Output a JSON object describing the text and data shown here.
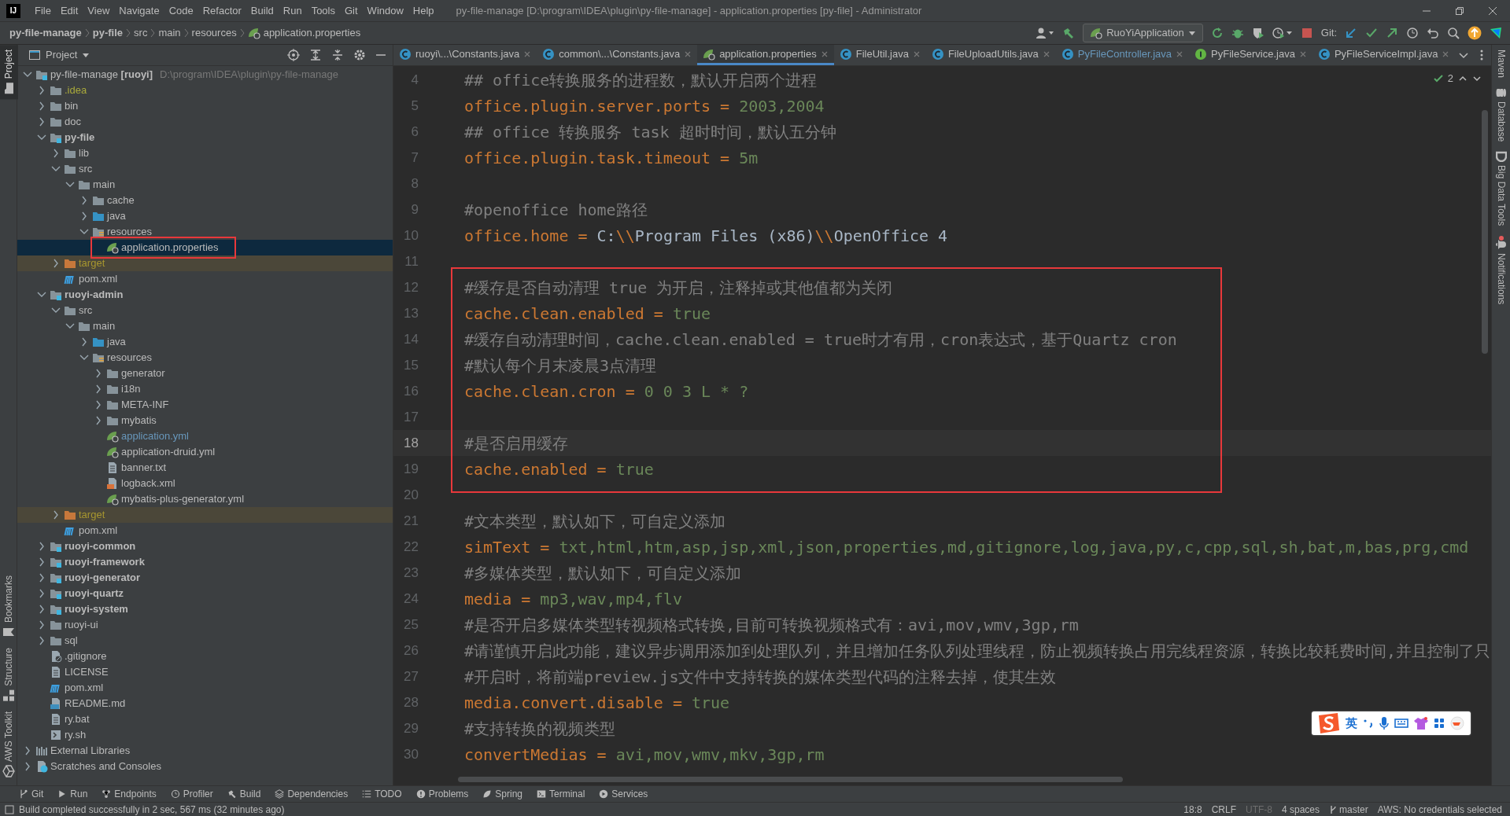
{
  "window": {
    "logo": "IJ",
    "menu": [
      "File",
      "Edit",
      "View",
      "Navigate",
      "Code",
      "Refactor",
      "Build",
      "Run",
      "Tools",
      "Git",
      "Window",
      "Help"
    ],
    "title": "py-file-manage [D:\\program\\IDEA\\plugin\\py-file-manage] - application.properties [py-file] - Administrator"
  },
  "navbar": {
    "breadcrumbs": [
      {
        "label": "py-file-manage",
        "bold": true,
        "kind": "module"
      },
      {
        "label": "py-file",
        "bold": true,
        "kind": "module"
      },
      {
        "label": "src",
        "bold": false,
        "kind": "folder"
      },
      {
        "label": "main",
        "bold": false,
        "kind": "folder"
      },
      {
        "label": "resources",
        "bold": false,
        "kind": "folder"
      },
      {
        "label": "application.properties",
        "bold": false,
        "kind": "spring"
      }
    ],
    "run_config": "RuoYiApplication",
    "git_label": "Git:"
  },
  "left_stripe": [
    {
      "label": "Project",
      "selected": true
    },
    {
      "label": "Bookmarks",
      "selected": false
    },
    {
      "label": "Structure",
      "selected": false
    },
    {
      "label": "AWS Toolkit",
      "selected": false
    }
  ],
  "project": {
    "title": "Project",
    "annotation_frame": true,
    "tree": [
      {
        "label": "py-file-manage **[ruoyi]**",
        "location": "D:\\program\\IDEA\\plugin\\py-file-manage",
        "kind": "project",
        "modified": false,
        "selected": false,
        "expanded": true,
        "children": [
          {
            "label": ".idea",
            "kind": "ignored",
            "modified": false,
            "selected": false,
            "expanded": false
          },
          {
            "label": "bin",
            "kind": "folder",
            "modified": false,
            "selected": false,
            "expanded": false
          },
          {
            "label": "doc",
            "kind": "folder",
            "modified": false,
            "selected": false,
            "expanded": false
          },
          {
            "label": "py-file",
            "kind": "module",
            "modified": false,
            "selected": false,
            "expanded": true,
            "children": [
              {
                "label": "lib",
                "kind": "folder",
                "modified": false,
                "selected": false,
                "expanded": false
              },
              {
                "label": "src",
                "kind": "folder",
                "modified": false,
                "selected": false,
                "expanded": true,
                "children": [
                  {
                    "label": "main",
                    "kind": "folder",
                    "modified": false,
                    "selected": false,
                    "expanded": true,
                    "children": [
                      {
                        "label": "cache",
                        "kind": "folder",
                        "modified": false,
                        "selected": false,
                        "expanded": false
                      },
                      {
                        "label": "java",
                        "kind": "source",
                        "modified": false,
                        "selected": false,
                        "expanded": false
                      },
                      {
                        "label": "resources",
                        "kind": "resources",
                        "modified": false,
                        "selected": false,
                        "expanded": true,
                        "children": [
                          {
                            "label": "application.properties",
                            "kind": "spring",
                            "modified": false,
                            "selected": true
                          }
                        ]
                      }
                    ]
                  }
                ]
              },
              {
                "label": "target",
                "kind": "excluded",
                "modified": false,
                "selected": false,
                "expanded": false
              },
              {
                "label": "pom.xml",
                "kind": "maven",
                "modified": false,
                "selected": false
              }
            ]
          },
          {
            "label": "ruoyi-admin",
            "kind": "module",
            "modified": false,
            "selected": false,
            "expanded": true,
            "children": [
              {
                "label": "src",
                "kind": "folder",
                "modified": false,
                "selected": false,
                "expanded": true,
                "children": [
                  {
                    "label": "main",
                    "kind": "folder",
                    "modified": false,
                    "selected": false,
                    "expanded": true,
                    "children": [
                      {
                        "label": "java",
                        "kind": "source",
                        "modified": false,
                        "selected": false,
                        "expanded": false
                      },
                      {
                        "label": "resources",
                        "kind": "resources",
                        "modified": false,
                        "selected": false,
                        "expanded": true,
                        "children": [
                          {
                            "label": "generator",
                            "kind": "folder",
                            "modified": false,
                            "selected": false,
                            "expanded": false
                          },
                          {
                            "label": "i18n",
                            "kind": "folder",
                            "modified": false,
                            "selected": false,
                            "expanded": false
                          },
                          {
                            "label": "META-INF",
                            "kind": "folder",
                            "modified": false,
                            "selected": false,
                            "expanded": false
                          },
                          {
                            "label": "mybatis",
                            "kind": "folder",
                            "modified": false,
                            "selected": false,
                            "expanded": false
                          },
                          {
                            "label": "application.yml",
                            "kind": "spring",
                            "modified": true,
                            "selected": false
                          },
                          {
                            "label": "application-druid.yml",
                            "kind": "spring",
                            "modified": false,
                            "selected": false
                          },
                          {
                            "label": "banner.txt",
                            "kind": "text",
                            "modified": false,
                            "selected": false
                          },
                          {
                            "label": "logback.xml",
                            "kind": "xml",
                            "modified": false,
                            "selected": false
                          },
                          {
                            "label": "mybatis-plus-generator.yml",
                            "kind": "spring",
                            "modified": false,
                            "selected": false
                          }
                        ]
                      }
                    ]
                  }
                ]
              },
              {
                "label": "target",
                "kind": "excluded",
                "modified": false,
                "selected": false,
                "expanded": false
              },
              {
                "label": "pom.xml",
                "kind": "maven",
                "modified": false,
                "selected": false
              }
            ]
          },
          {
            "label": "ruoyi-common",
            "kind": "module",
            "modified": false,
            "selected": false,
            "expanded": false
          },
          {
            "label": "ruoyi-framework",
            "kind": "module",
            "modified": false,
            "selected": false,
            "expanded": false
          },
          {
            "label": "ruoyi-generator",
            "kind": "module",
            "modified": false,
            "selected": false,
            "expanded": false
          },
          {
            "label": "ruoyi-quartz",
            "kind": "module",
            "modified": false,
            "selected": false,
            "expanded": false
          },
          {
            "label": "ruoyi-system",
            "kind": "module",
            "modified": false,
            "selected": false,
            "expanded": false
          },
          {
            "label": "ruoyi-ui",
            "kind": "folder",
            "modified": false,
            "selected": false,
            "expanded": false
          },
          {
            "label": "sql",
            "kind": "folder",
            "modified": false,
            "selected": false,
            "expanded": false
          },
          {
            "label": ".gitignore",
            "kind": "gitignore",
            "modified": false,
            "selected": false
          },
          {
            "label": "LICENSE",
            "kind": "text",
            "modified": false,
            "selected": false
          },
          {
            "label": "pom.xml",
            "kind": "maven",
            "modified": false,
            "selected": false
          },
          {
            "label": "README.md",
            "kind": "markdown",
            "modified": false,
            "selected": false
          },
          {
            "label": "ry.bat",
            "kind": "text",
            "modified": false,
            "selected": false
          },
          {
            "label": "ry.sh",
            "kind": "shell",
            "modified": false,
            "selected": false
          }
        ]
      },
      {
        "label": "External Libraries",
        "kind": "libraries",
        "modified": false,
        "selected": false,
        "expanded": false
      },
      {
        "label": "Scratches and Consoles",
        "kind": "scratches",
        "modified": false,
        "selected": false,
        "expanded": false
      }
    ]
  },
  "editor": {
    "tabs": [
      {
        "label": "ruoyi\\...\\Constants.java",
        "kind": "class",
        "modified": false,
        "selected": false
      },
      {
        "label": "common\\...\\Constants.java",
        "kind": "class",
        "modified": false,
        "selected": false
      },
      {
        "label": "application.properties",
        "kind": "spring",
        "modified": false,
        "selected": true
      },
      {
        "label": "FileUtil.java",
        "kind": "class",
        "modified": false,
        "selected": false
      },
      {
        "label": "FileUploadUtils.java",
        "kind": "class",
        "modified": false,
        "selected": false
      },
      {
        "label": "PyFileController.java",
        "kind": "class",
        "modified": true,
        "selected": false
      },
      {
        "label": "PyFileService.java",
        "kind": "interface",
        "modified": false,
        "selected": false
      },
      {
        "label": "PyFileServiceImpl.java",
        "kind": "class",
        "modified": false,
        "selected": false
      }
    ],
    "inspections": "2",
    "blocks": [
      {
        "boxed": false,
        "lines": [
          {
            "number": "4",
            "current": false,
            "segments": [
              {
                "kind": "comment",
                "text": "## office转换服务的进程数，默认开启两个进程"
              }
            ]
          },
          {
            "number": "5",
            "current": false,
            "segments": [
              {
                "kind": "key",
                "text": "office.plugin.server.ports = "
              },
              {
                "kind": "value",
                "text": "2003,2004"
              }
            ]
          },
          {
            "number": "6",
            "current": false,
            "segments": [
              {
                "kind": "comment",
                "text": "## office 转换服务 task 超时时间，默认五分钟"
              }
            ]
          },
          {
            "number": "7",
            "current": false,
            "segments": [
              {
                "kind": "key",
                "text": "office.plugin.task.timeout = "
              },
              {
                "kind": "value",
                "text": "5m"
              }
            ]
          },
          {
            "number": "8",
            "current": false
          },
          {
            "number": "9",
            "current": false,
            "segments": [
              {
                "kind": "comment",
                "text": "#openoffice home路径"
              }
            ]
          },
          {
            "number": "10",
            "current": false,
            "segments": [
              {
                "kind": "key",
                "text": "office.home = "
              },
              {
                "kind": "plain",
                "text": "C:"
              },
              {
                "kind": "escape",
                "text": "\\\\"
              },
              {
                "kind": "plain",
                "text": "Program Files (x86)"
              },
              {
                "kind": "escape",
                "text": "\\\\"
              },
              {
                "kind": "plain",
                "text": "OpenOffice 4"
              }
            ]
          },
          {
            "number": "11",
            "current": false
          }
        ]
      },
      {
        "boxed": true,
        "lines": [
          {
            "number": "12",
            "current": false,
            "segments": [
              {
                "kind": "comment",
                "text": "#缓存是否自动清理 true 为开启，注释掉或其他值都为关闭"
              }
            ]
          },
          {
            "number": "13",
            "current": false,
            "segments": [
              {
                "kind": "key",
                "text": "cache.clean.enabled = "
              },
              {
                "kind": "value",
                "text": "true"
              }
            ]
          },
          {
            "number": "14",
            "current": false,
            "segments": [
              {
                "kind": "comment",
                "text": "#缓存自动清理时间，cache.clean.enabled = true时才有用，cron表达式，基于Quartz cron"
              }
            ]
          },
          {
            "number": "15",
            "current": false,
            "segments": [
              {
                "kind": "comment",
                "text": "#默认每个月末凌晨3点清理"
              }
            ]
          },
          {
            "number": "16",
            "current": false,
            "segments": [
              {
                "kind": "key",
                "text": "cache.clean.cron = "
              },
              {
                "kind": "value",
                "text": "0 0 3 L * ?"
              }
            ]
          },
          {
            "number": "17",
            "current": false
          },
          {
            "number": "18",
            "current": true,
            "segments": [
              {
                "kind": "comment",
                "text": "#是否启用缓存"
              }
            ]
          },
          {
            "number": "19",
            "current": false,
            "segments": [
              {
                "kind": "key",
                "text": "cache.enabled = "
              },
              {
                "kind": "value",
                "text": "true"
              }
            ]
          }
        ]
      },
      {
        "boxed": false,
        "lines": [
          {
            "number": "20",
            "current": false
          },
          {
            "number": "21",
            "current": false,
            "segments": [
              {
                "kind": "comment",
                "text": "#文本类型，默认如下，可自定义添加"
              }
            ]
          },
          {
            "number": "22",
            "current": false,
            "segments": [
              {
                "kind": "key",
                "text": "simText = "
              },
              {
                "kind": "value",
                "text": "txt,html,htm,asp,jsp,xml,json,properties,md,gitignore,log,java,py,c,cpp,sql,sh,bat,m,bas,prg,cmd"
              }
            ]
          },
          {
            "number": "23",
            "current": false,
            "segments": [
              {
                "kind": "comment",
                "text": "#多媒体类型，默认如下，可自定义添加"
              }
            ]
          },
          {
            "number": "24",
            "current": false,
            "segments": [
              {
                "kind": "key",
                "text": "media = "
              },
              {
                "kind": "value",
                "text": "mp3,wav,mp4,flv"
              }
            ]
          },
          {
            "number": "25",
            "current": false,
            "segments": [
              {
                "kind": "comment",
                "text": "#是否开启多媒体类型转视频格式转换,目前可转换视频格式有：avi,mov,wmv,3gp,rm"
              }
            ]
          },
          {
            "number": "26",
            "current": false,
            "segments": [
              {
                "kind": "comment",
                "text": "#请谨慎开启此功能，建议异步调用添加到处理队列，并且增加任务队列处理线程，防止视频转换占用完线程资源，转换比较耗费时间,并且控制了只"
              }
            ]
          },
          {
            "number": "27",
            "current": false,
            "segments": [
              {
                "kind": "comment",
                "text": "#开启时，将前端preview.js文件中支持转换的媒体类型代码的注释去掉，使其生效"
              }
            ]
          },
          {
            "number": "28",
            "current": false,
            "segments": [
              {
                "kind": "key",
                "text": "media.convert.disable = "
              },
              {
                "kind": "value",
                "text": "true"
              }
            ]
          },
          {
            "number": "29",
            "current": false,
            "segments": [
              {
                "kind": "comment",
                "text": "#支持转换的视频类型"
              }
            ]
          },
          {
            "number": "30",
            "current": false,
            "segments": [
              {
                "kind": "key",
                "text": "convertMedias = "
              },
              {
                "kind": "value",
                "text": "avi,mov,wmv,mkv,3gp,rm"
              }
            ]
          }
        ]
      }
    ]
  },
  "right_stripe": [
    {
      "label": "Maven",
      "notification": false
    },
    {
      "label": "Database",
      "notification": false
    },
    {
      "label": "Big Data Tools",
      "notification": false
    },
    {
      "label": "Notifications",
      "notification": true
    }
  ],
  "ime": {
    "mode": "英"
  },
  "tool_windows": [
    "Git",
    "Run",
    "Endpoints",
    "Profiler",
    "Build",
    "Dependencies",
    "TODO",
    "Problems",
    "Spring",
    "Terminal",
    "Services"
  ],
  "status_bar": {
    "message": "Build completed successfully in 2 sec, 567 ms (32 minutes ago)",
    "items": [
      {
        "text": "18:8",
        "kind": "text",
        "disabled": false
      },
      {
        "text": "CRLF",
        "kind": "text",
        "disabled": false
      },
      {
        "text": "UTF-8",
        "kind": "text",
        "disabled": true
      },
      {
        "text": "4 spaces",
        "kind": "text",
        "disabled": false
      },
      {
        "text": "master",
        "kind": "branch",
        "disabled": false
      },
      {
        "text": "AWS: No credentials selected",
        "kind": "text",
        "disabled": false
      }
    ]
  }
}
